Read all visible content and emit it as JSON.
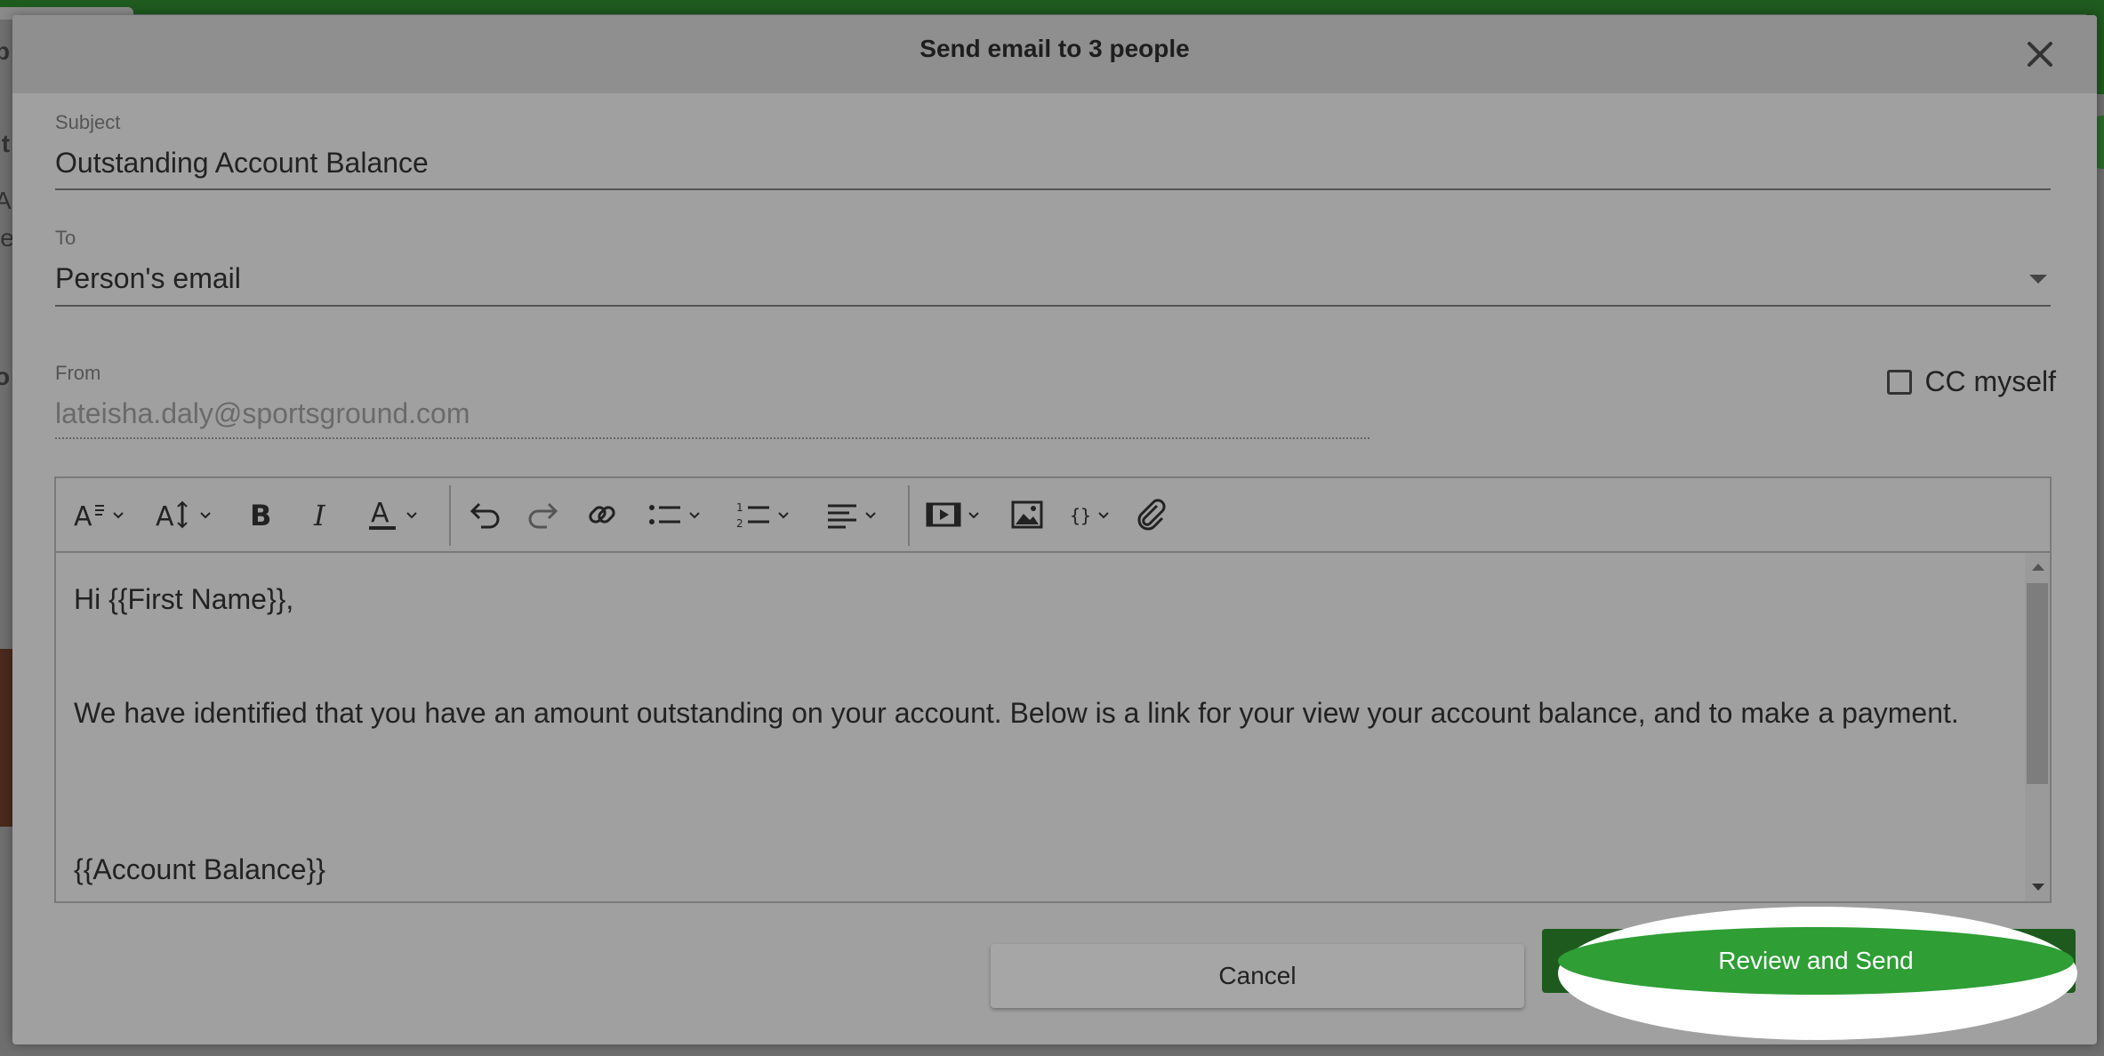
{
  "modal": {
    "title": "Send email to 3 people",
    "close_icon": "close-icon"
  },
  "subject": {
    "label": "Subject",
    "value": "Outstanding Account Balance"
  },
  "to": {
    "label": "To",
    "value": "Person's email"
  },
  "from": {
    "label": "From",
    "value": "lateisha.daly@sportsground.com"
  },
  "cc": {
    "label": "CC myself",
    "checked": false
  },
  "toolbar": {
    "items": [
      "font-style-icon",
      "font-size-icon",
      "bold-icon",
      "italic-icon",
      "text-color-icon",
      "undo-icon",
      "redo-icon",
      "link-icon",
      "bullet-list-icon",
      "numbered-list-icon",
      "align-icon",
      "video-icon",
      "image-icon",
      "merge-field-icon",
      "attachment-icon"
    ]
  },
  "editor": {
    "lines": [
      "Hi {{First Name}},",
      "",
      "We have identified that you have an amount outstanding on your account. Below is a link for your view your account balance, and to make a payment.",
      "",
      "",
      "{{Account Balance}}"
    ]
  },
  "footer": {
    "cancel_label": "Cancel",
    "send_label": "Review and Send"
  },
  "colors": {
    "primary_green": "#2e9e35",
    "dark_green": "#1e5a1e",
    "overlay_gray": "#a0a0a0"
  },
  "background_fragments": {
    "letters": [
      "p",
      "lt",
      "A",
      "le",
      "o"
    ]
  }
}
